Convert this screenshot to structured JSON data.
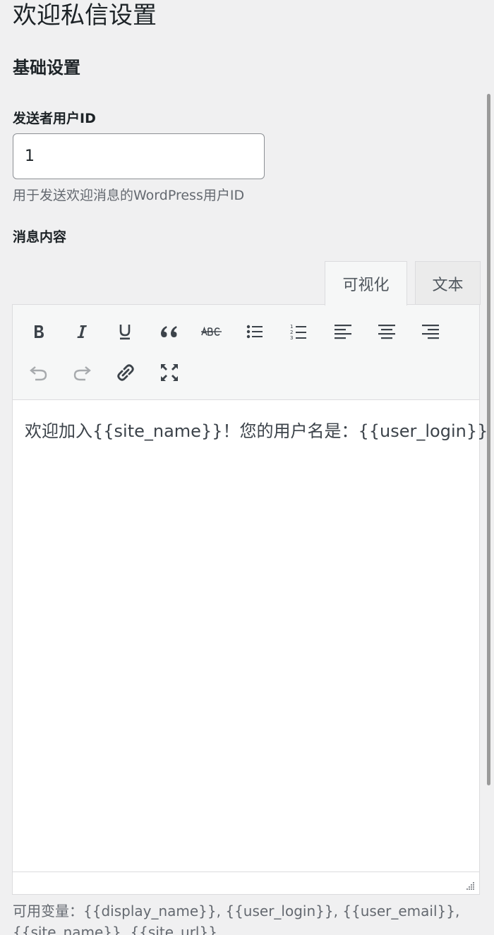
{
  "page": {
    "title": "欢迎私信设置"
  },
  "basic": {
    "section_title": "基础设置"
  },
  "sender": {
    "label": "发送者用户ID",
    "value": "1",
    "description": "用于发送欢迎消息的WordPress用户ID"
  },
  "message": {
    "label": "消息内容",
    "content": "欢迎加入{{site_name}}！您的用户名是：{{user_login}}"
  },
  "editor": {
    "tabs": [
      {
        "label": "可视化",
        "active": true
      },
      {
        "label": "文本",
        "active": false
      }
    ],
    "toolbar_icons": [
      "bold-icon",
      "italic-icon",
      "underline-icon",
      "blockquote-icon",
      "strikethrough-icon",
      "bulleted-list-icon",
      "numbered-list-icon",
      "align-left-icon",
      "align-center-icon",
      "align-right-icon",
      "undo-icon",
      "redo-icon",
      "link-icon",
      "fullscreen-icon"
    ]
  },
  "help": {
    "line1": "可用变量：{{display_name}}, {{user_login}}, {{user_email}},",
    "line2": "{{site_name}}, {{site_url}}"
  },
  "colors": {
    "background": "#f0f0f1",
    "text": "#1d2327",
    "muted": "#646970",
    "border": "#dcdcde"
  }
}
